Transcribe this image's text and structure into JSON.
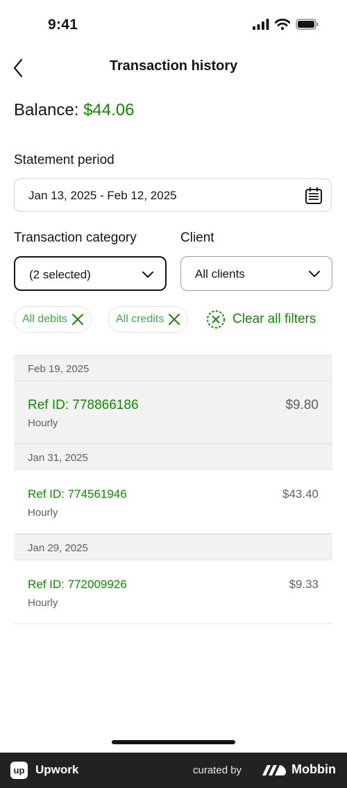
{
  "status_bar": {
    "time": "9:41",
    "icons": [
      "signal-icon",
      "wifi-icon",
      "battery-icon"
    ]
  },
  "header": {
    "title": "Transaction history",
    "back_icon": "chevron-left-icon"
  },
  "balance": {
    "label": "Balance:",
    "amount": "$44.06"
  },
  "statement_period": {
    "label": "Statement period",
    "value": "Jan 13, 2025 - Feb 12, 2025",
    "icon": "calendar-icon"
  },
  "category": {
    "label": "Transaction category",
    "value": "(2 selected)"
  },
  "client": {
    "label": "Client",
    "value": "All clients"
  },
  "filters": {
    "chips": [
      {
        "label": "All debits"
      },
      {
        "label": "All credits"
      }
    ],
    "clear_all": "Clear all filters"
  },
  "transactions": [
    {
      "date": "Feb 19, 2025",
      "ref": "Ref ID: 778866186",
      "type": "Hourly",
      "amount": "$9.80"
    },
    {
      "date": "Jan 31, 2025",
      "ref": "Ref ID: 774561946",
      "type": "Hourly",
      "amount": "$43.40"
    },
    {
      "date": "Jan 29, 2025",
      "ref": "Ref ID: 772009926",
      "type": "Hourly",
      "amount": "$9.33"
    }
  ],
  "footer": {
    "brand": "Upwork",
    "logo_text": "up",
    "curated_by": "curated by",
    "mobbin": "Mobbin"
  },
  "colors": {
    "accent_green": "#108a00",
    "chip_green": "#3aa84a",
    "footer_bg": "#222222"
  }
}
